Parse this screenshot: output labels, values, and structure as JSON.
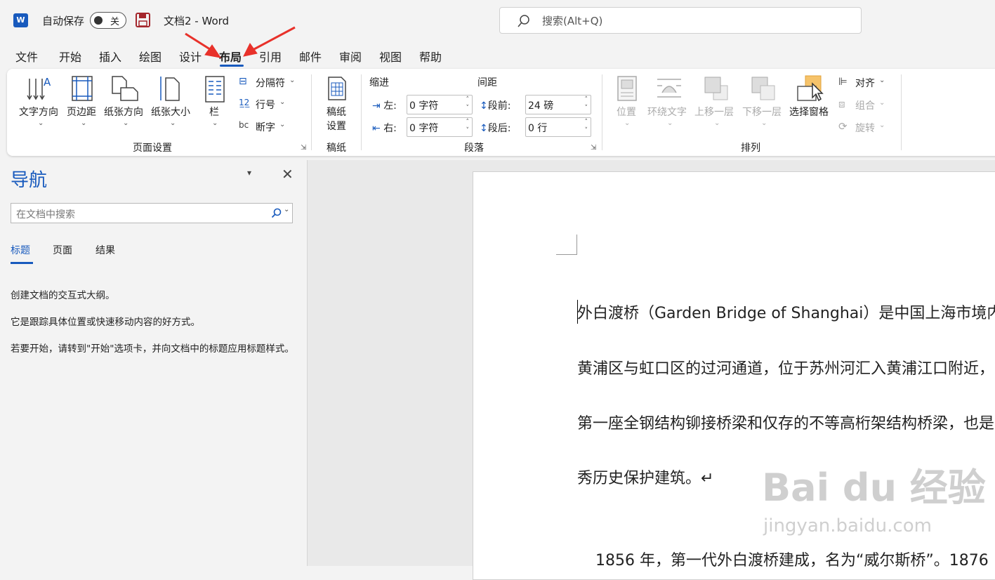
{
  "titlebar": {
    "logo": "W",
    "autosave_label": "自动保存",
    "toggle_state": "关",
    "doc_title": "文档2 - Word",
    "search_placeholder": "搜索(Alt+Q)"
  },
  "menu_tabs": [
    "文件",
    "开始",
    "插入",
    "绘图",
    "设计",
    "布局",
    "引用",
    "邮件",
    "审阅",
    "视图",
    "帮助"
  ],
  "active_tab": "布局",
  "ribbon": {
    "page_setup": {
      "text_direction": "文字方向",
      "margins": "页边距",
      "orientation": "纸张方向",
      "size": "纸张大小",
      "columns": "栏",
      "breaks": "分隔符",
      "line_numbers": "行号",
      "hyphenation": "断字",
      "group_label": "页面设置"
    },
    "manuscript": {
      "button_line1": "稿纸",
      "button_line2": "设置",
      "group_label": "稿纸"
    },
    "paragraph": {
      "indent_title": "缩进",
      "spacing_title": "间距",
      "left_label": "左:",
      "right_label": "右:",
      "left_value": "0 字符",
      "right_value": "0 字符",
      "before_label": "段前:",
      "after_label": "段后:",
      "before_value": "24 磅",
      "after_value": "0 行",
      "group_label": "段落"
    },
    "arrange": {
      "position": "位置",
      "wrap_text": "环绕文字",
      "bring_forward": "上移一层",
      "send_backward": "下移一层",
      "selection_pane": "选择窗格",
      "align": "对齐",
      "group": "组合",
      "rotate": "旋转",
      "group_label": "排列"
    }
  },
  "nav": {
    "title": "导航",
    "search_placeholder": "在文档中搜索",
    "tabs": [
      "标题",
      "页面",
      "结果"
    ],
    "text1": "创建文档的交互式大纲。",
    "text2": "它是跟踪具体位置或快速移动内容的好方式。",
    "text3": "若要开始，请转到\"开始\"选项卡，并向文档中的标题应用标题样式。"
  },
  "document": {
    "lines": [
      "外白渡桥（Garden Bridge of Shanghai）是中国上海市境内",
      "黄浦区与虹口区的过河通道，位于苏州河汇入黄浦江口附近，",
      "第一座全钢结构铆接桥梁和仅存的不等高桁架结构桥梁，也是",
      "秀历史保护建筑。↵",
      "1856 年，第一代外白渡桥建成，名为“威尔斯桥”。1876"
    ]
  },
  "watermark": {
    "logo_text": "Bai du 经验",
    "url": "jingyan.baidu.com"
  },
  "colors": {
    "accent": "#185abd",
    "annotation_arrow": "#e8312a",
    "background": "#f3f3f3"
  }
}
